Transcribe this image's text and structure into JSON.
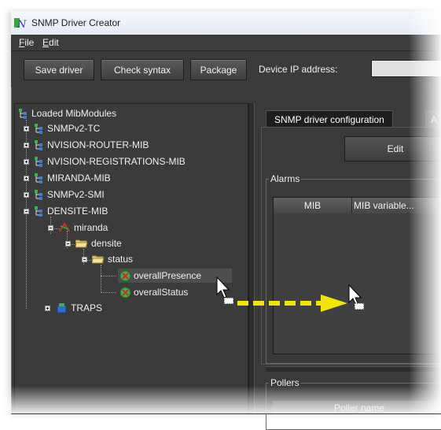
{
  "window": {
    "title": "SNMP Driver Creator"
  },
  "menu": {
    "file": "File",
    "edit": "Edit"
  },
  "toolbar": {
    "save_driver": "Save driver",
    "check_syntax": "Check syntax",
    "package": "Package",
    "device_ip_label": "Device IP address:",
    "device_ip_value": ""
  },
  "tree": {
    "root": "Loaded MibModules",
    "modules": [
      "SNMPv2-TC",
      "NVISION-ROUTER-MIB",
      "NVISION-REGISTRATIONS-MIB",
      "MIRANDA-MIB",
      "SNMPv2-SMI",
      "DENSITE-MIB"
    ],
    "miranda": "miranda",
    "densite": "densite",
    "status": "status",
    "overall_presence": "overallPresence",
    "overall_status": "overallStatus",
    "traps": "TRAPS"
  },
  "right": {
    "tab_active": "SNMP driver configuration",
    "tab_inactive": "A",
    "edit_button": "Edit",
    "alarms_label": "Alarms",
    "alarms_columns": [
      "MIB",
      "MIB variable..."
    ],
    "pollers_label": "Pollers",
    "pollers_columns": [
      "Poller name"
    ]
  },
  "colors": {
    "drag_arrow": "#f2e600",
    "accent_red": "#cc2020",
    "accent_green": "#2fa82f"
  }
}
